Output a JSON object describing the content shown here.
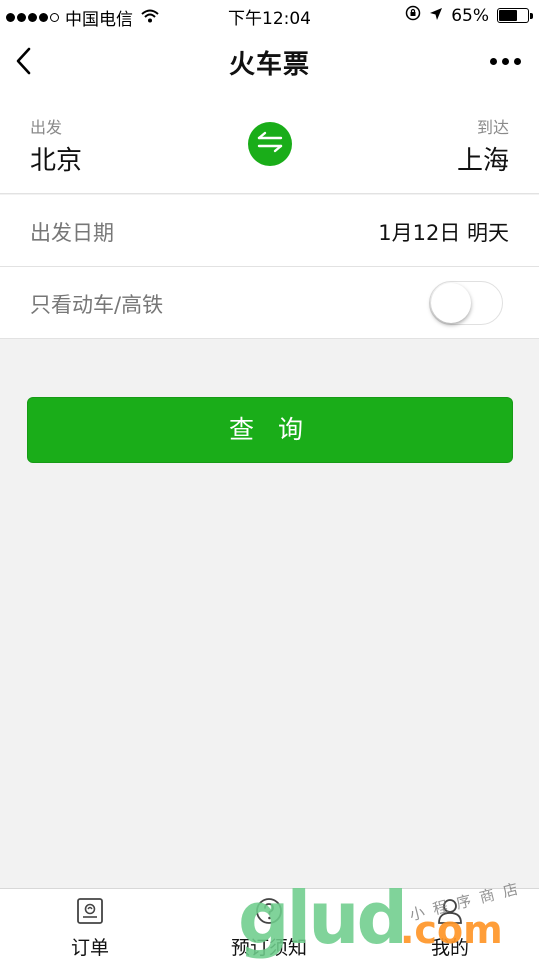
{
  "status_bar": {
    "carrier": "中国电信",
    "time": "下午12:04",
    "battery": "65%",
    "battery_level": 0.65
  },
  "nav": {
    "title": "火车票"
  },
  "route": {
    "from_label": "出发",
    "from_city": "北京",
    "to_label": "到达",
    "to_city": "上海"
  },
  "date_row": {
    "label": "出发日期",
    "value": "1月12日 明天"
  },
  "highspeed_row": {
    "label": "只看动车/高铁",
    "enabled": false
  },
  "query_button": {
    "label": "查 询"
  },
  "tabs": [
    {
      "label": "订单",
      "icon": "orders-icon"
    },
    {
      "label": "预订须知",
      "icon": "question-icon"
    },
    {
      "label": "我的",
      "icon": "user-icon"
    }
  ],
  "watermark": {
    "main": "glud",
    "suffix": ".com",
    "handwriting": "小程序商店"
  },
  "colors": {
    "accent": "#1aad19",
    "background": "#f2f2f2"
  }
}
